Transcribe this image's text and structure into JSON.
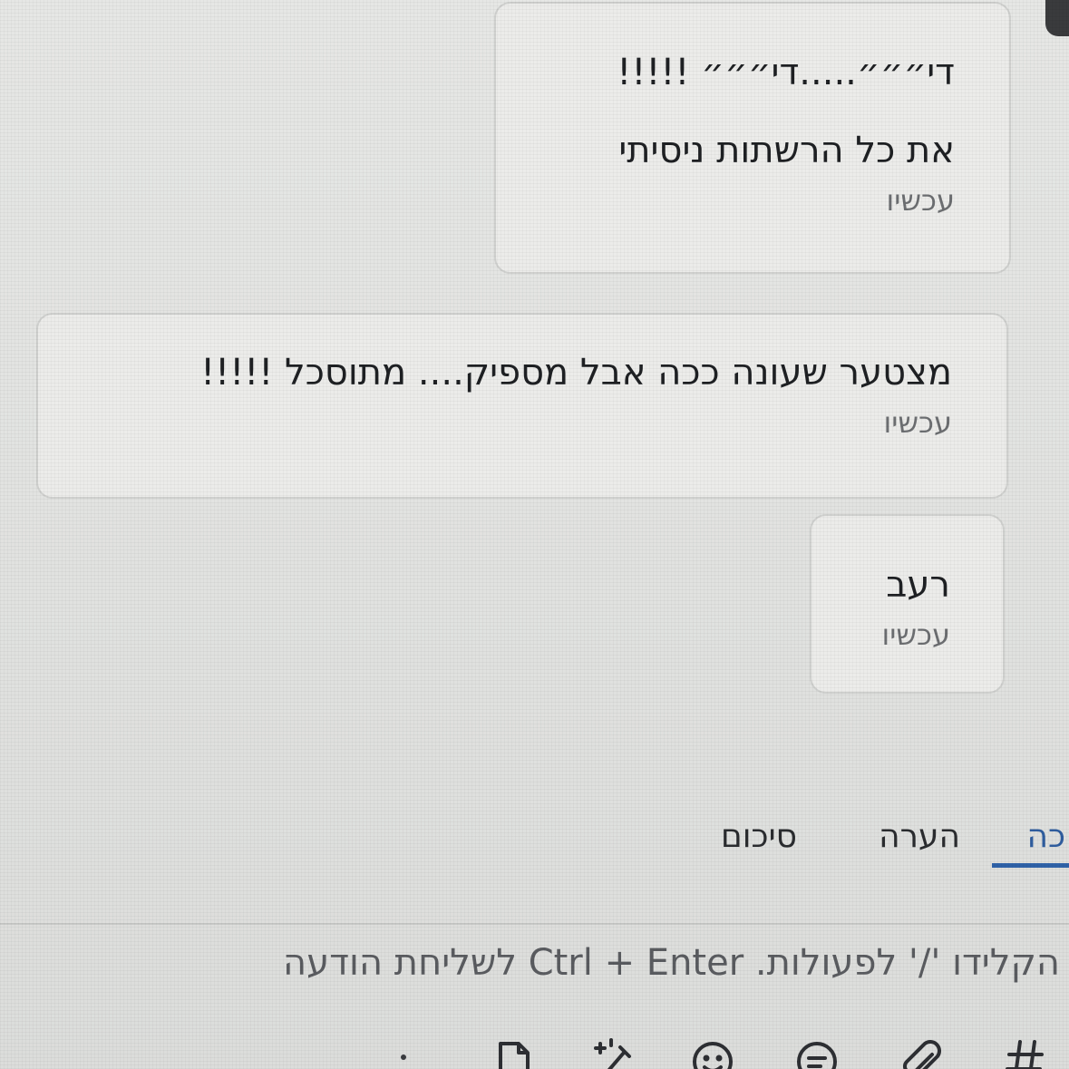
{
  "messages": [
    {
      "lines": [
        "די״״״.....די״״״ !!!!!",
        "את כל הרשתות ניסיתי"
      ],
      "time": "עכשיו"
    },
    {
      "lines": [
        "מצטער שעונה ככה אבל מספיק.... מתוסכל !!!!!"
      ],
      "time": "עכשיו"
    },
    {
      "lines": [
        "רעב"
      ],
      "time": "עכשיו"
    }
  ],
  "tabs": {
    "message": "כה",
    "note": "הערה",
    "summary": "סיכום"
  },
  "composer": {
    "placeholder": "הקלידו '/' לפעולות. Ctrl + Enter לשליחת הודעה"
  },
  "toolbar": {
    "icons": [
      "hash-icon",
      "paperclip-icon",
      "canned-response-icon",
      "emoji-icon",
      "magic-wand-icon",
      "document-icon"
    ]
  },
  "colors": {
    "active_tab": "#2f62a8",
    "bubble_bg": "#ececea",
    "timestamp": "#6c6e71"
  }
}
